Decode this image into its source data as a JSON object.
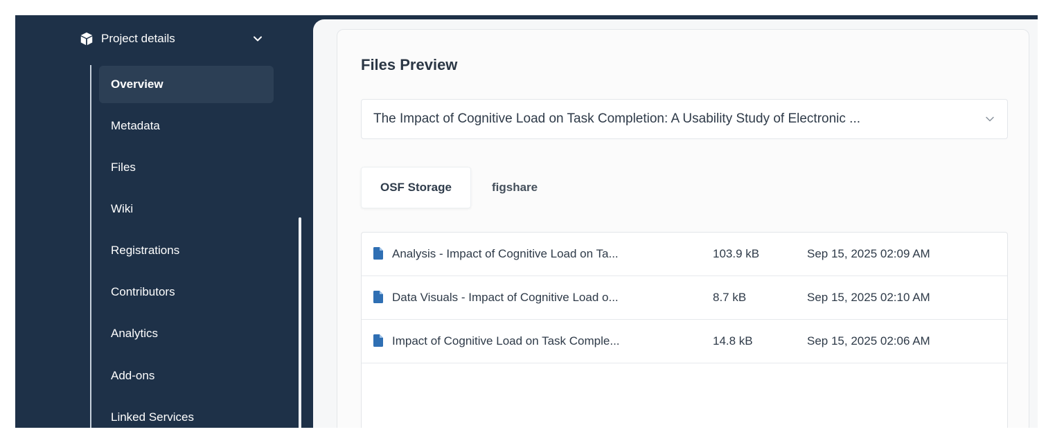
{
  "sidebar": {
    "project": {
      "label": "Project details",
      "icon": "cube-icon"
    },
    "items": [
      {
        "label": "Overview",
        "active": true
      },
      {
        "label": "Metadata"
      },
      {
        "label": "Files"
      },
      {
        "label": "Wiki"
      },
      {
        "label": "Registrations"
      },
      {
        "label": "Contributors"
      },
      {
        "label": "Analytics"
      },
      {
        "label": "Add-ons"
      },
      {
        "label": "Linked Services"
      }
    ]
  },
  "main": {
    "title": "Files Preview",
    "project_select": {
      "value": "The Impact of Cognitive Load on Task Completion: A Usability Study of Electronic ..."
    },
    "tabs": [
      {
        "label": "OSF Storage",
        "active": true
      },
      {
        "label": "figshare"
      }
    ],
    "files": [
      {
        "name": "Analysis - Impact of Cognitive Load on Ta...",
        "size": "103.9 kB",
        "modified": "Sep 15, 2025 02:09 AM"
      },
      {
        "name": "Data Visuals - Impact of Cognitive Load o...",
        "size": "8.7 kB",
        "modified": "Sep 15, 2025 02:10 AM"
      },
      {
        "name": "Impact of Cognitive Load on Task Comple...",
        "size": "14.8 kB",
        "modified": "Sep 15, 2025 02:06 AM"
      }
    ]
  },
  "colors": {
    "sidebar_bg": "#1e3148",
    "active_item_bg": "#2c3f55",
    "file_icon": "#2f6fb3",
    "panel_bg": "#f6f7f8"
  }
}
